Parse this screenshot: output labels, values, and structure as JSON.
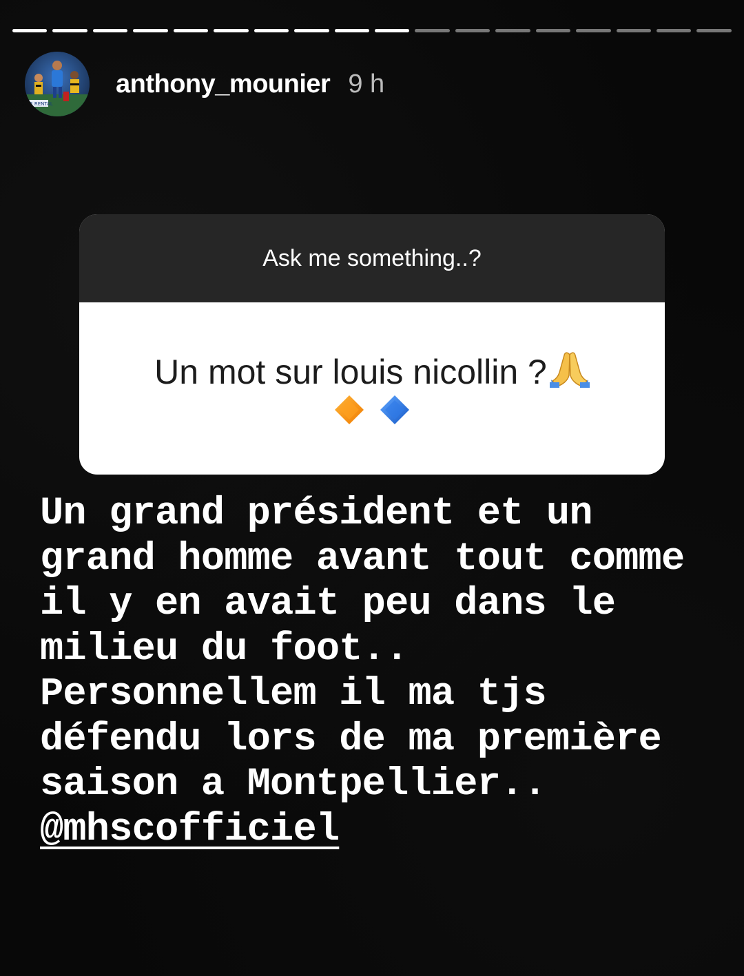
{
  "story": {
    "progress": {
      "total_segments": 18,
      "completed_segments": 10
    },
    "header": {
      "username": "anthony_mounier",
      "time_ago": "9 h",
      "avatar_icon": "profile-photo-footballer",
      "avatar_caption": "AR RENTAL"
    },
    "question_sticker": {
      "prompt": "Ask me something..?",
      "question": "Un mot sur louis nicollin ?",
      "icons": [
        "folded-hands-emoji",
        "orange-diamond-emoji",
        "blue-diamond-emoji"
      ],
      "header_color": "#262626",
      "body_color": "#ffffff"
    },
    "answer": {
      "lines": [
        "Un grand président et un",
        "grand homme avant tout comme",
        "il y en avait peu dans le",
        "milieu du foot..",
        "Personnellem il ma tjs",
        "défendu lors de ma première",
        "saison a Montpellier.."
      ],
      "mention": "@mhscofficiel"
    }
  }
}
